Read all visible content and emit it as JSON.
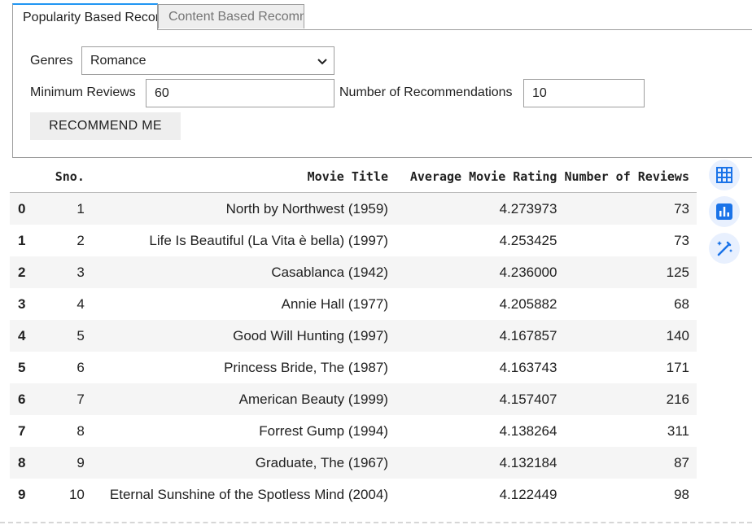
{
  "tabs": [
    {
      "label": "Popularity Based Recommendation"
    },
    {
      "label": "Content Based Recommendation"
    }
  ],
  "form": {
    "genres_label": "Genres",
    "genres_value": "Romance",
    "min_reviews_label": "Minimum Reviews",
    "min_reviews_value": "60",
    "num_recs_label": "Number of Recommendations",
    "num_recs_value": "10",
    "button_label": "RECOMMEND ME"
  },
  "table": {
    "columns": [
      "Sno.",
      "Movie Title",
      "Average Movie Rating",
      "Number of Reviews"
    ],
    "rows": [
      {
        "idx": "0",
        "sno": "1",
        "title": "North by Northwest (1959)",
        "rating": "4.273973",
        "reviews": "73"
      },
      {
        "idx": "1",
        "sno": "2",
        "title": "Life Is Beautiful (La Vita è bella) (1997)",
        "rating": "4.253425",
        "reviews": "73"
      },
      {
        "idx": "2",
        "sno": "3",
        "title": "Casablanca (1942)",
        "rating": "4.236000",
        "reviews": "125"
      },
      {
        "idx": "3",
        "sno": "4",
        "title": "Annie Hall (1977)",
        "rating": "4.205882",
        "reviews": "68"
      },
      {
        "idx": "4",
        "sno": "5",
        "title": "Good Will Hunting (1997)",
        "rating": "4.167857",
        "reviews": "140"
      },
      {
        "idx": "5",
        "sno": "6",
        "title": "Princess Bride, The (1987)",
        "rating": "4.163743",
        "reviews": "171"
      },
      {
        "idx": "6",
        "sno": "7",
        "title": "American Beauty (1999)",
        "rating": "4.157407",
        "reviews": "216"
      },
      {
        "idx": "7",
        "sno": "8",
        "title": "Forrest Gump (1994)",
        "rating": "4.138264",
        "reviews": "311"
      },
      {
        "idx": "8",
        "sno": "9",
        "title": "Graduate, The (1967)",
        "rating": "4.132184",
        "reviews": "87"
      },
      {
        "idx": "9",
        "sno": "10",
        "title": "Eternal Sunshine of the Spotless Mind (2004)",
        "rating": "4.122449",
        "reviews": "98"
      }
    ]
  },
  "side_icons": [
    "table-icon",
    "bar-chart-icon",
    "magic-wand-icon"
  ],
  "colors": {
    "accent": "#2196f3",
    "icon": "#1a73e8",
    "icon_bg": "#e8f0fe"
  }
}
